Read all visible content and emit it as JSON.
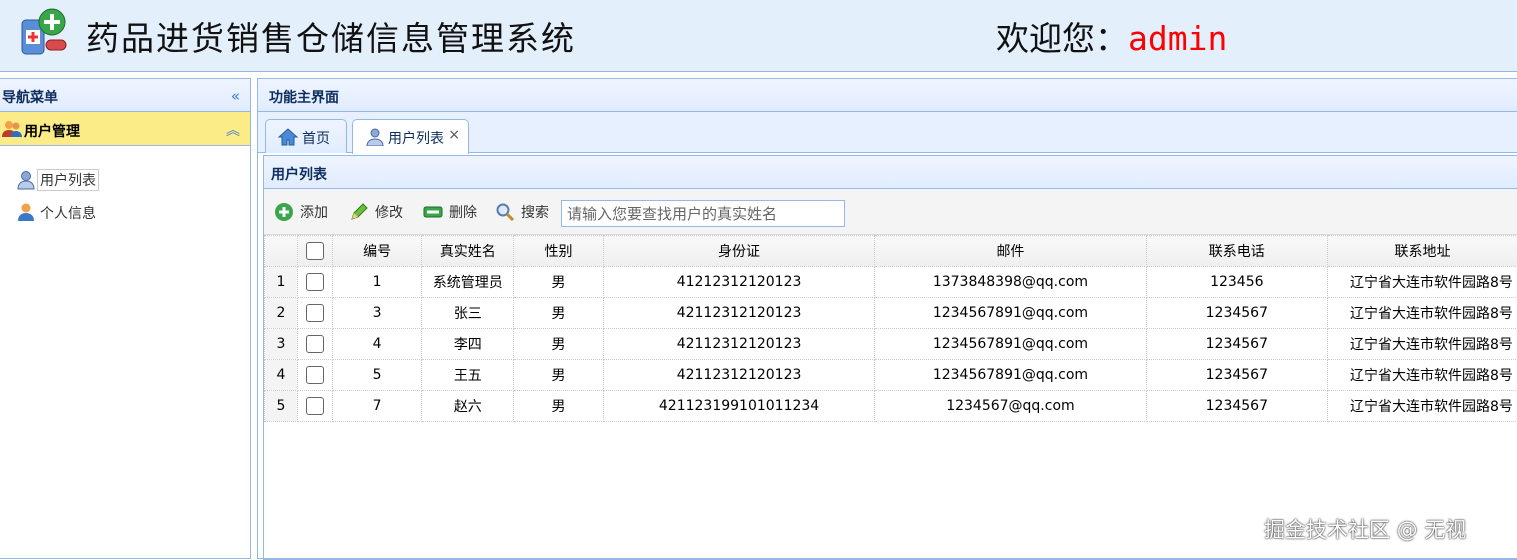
{
  "header": {
    "title": "药品进货销售仓储信息管理系统",
    "welcome_label": "欢迎您：",
    "username": "admin"
  },
  "west": {
    "title": "导航菜单",
    "group_title": "用户管理",
    "items": [
      {
        "label": "用户列表",
        "icon": "user-list-icon"
      },
      {
        "label": "个人信息",
        "icon": "person-icon"
      }
    ]
  },
  "center": {
    "title": "功能主界面",
    "tabs": [
      {
        "label": "首页",
        "icon": "home-icon"
      },
      {
        "label": "用户列表",
        "icon": "user-list-icon",
        "closable": true
      }
    ],
    "close_glyph": "×"
  },
  "panel": {
    "title": "用户列表",
    "toolbar": {
      "add_label": "添加",
      "edit_label": "修改",
      "delete_label": "删除",
      "search_label": "搜索",
      "search_placeholder": "请输入您要查找用户的真实姓名"
    }
  },
  "grid": {
    "columns": [
      "编号",
      "真实姓名",
      "性别",
      "身份证",
      "邮件",
      "联系电话",
      "联系地址"
    ],
    "rows": [
      {
        "rownum": "1",
        "id": "1",
        "name": "系统管理员",
        "gender": "男",
        "idcard": "41212312120123",
        "email": "1373848398@qq.com",
        "phone": "123456",
        "address": "辽宁省大连市软件园路8号"
      },
      {
        "rownum": "2",
        "id": "3",
        "name": "张三",
        "gender": "男",
        "idcard": "42112312120123",
        "email": "1234567891@qq.com",
        "phone": "1234567",
        "address": "辽宁省大连市软件园路8号"
      },
      {
        "rownum": "3",
        "id": "4",
        "name": "李四",
        "gender": "男",
        "idcard": "42112312120123",
        "email": "1234567891@qq.com",
        "phone": "1234567",
        "address": "辽宁省大连市软件园路8号"
      },
      {
        "rownum": "4",
        "id": "5",
        "name": "王五",
        "gender": "男",
        "idcard": "42112312120123",
        "email": "1234567891@qq.com",
        "phone": "1234567",
        "address": "辽宁省大连市软件园路8号"
      },
      {
        "rownum": "5",
        "id": "7",
        "name": "赵六",
        "gender": "男",
        "idcard": "421123199101011234",
        "email": "1234567@qq.com",
        "phone": "1234567",
        "address": "辽宁省大连市软件园路8号"
      }
    ]
  },
  "watermark": "掘金技术社区 @ 无视",
  "colors": {
    "accent": "#95b8e7",
    "header_bg": "#e3effb",
    "group_bg": "#fbec88",
    "username": "#ff0000"
  }
}
